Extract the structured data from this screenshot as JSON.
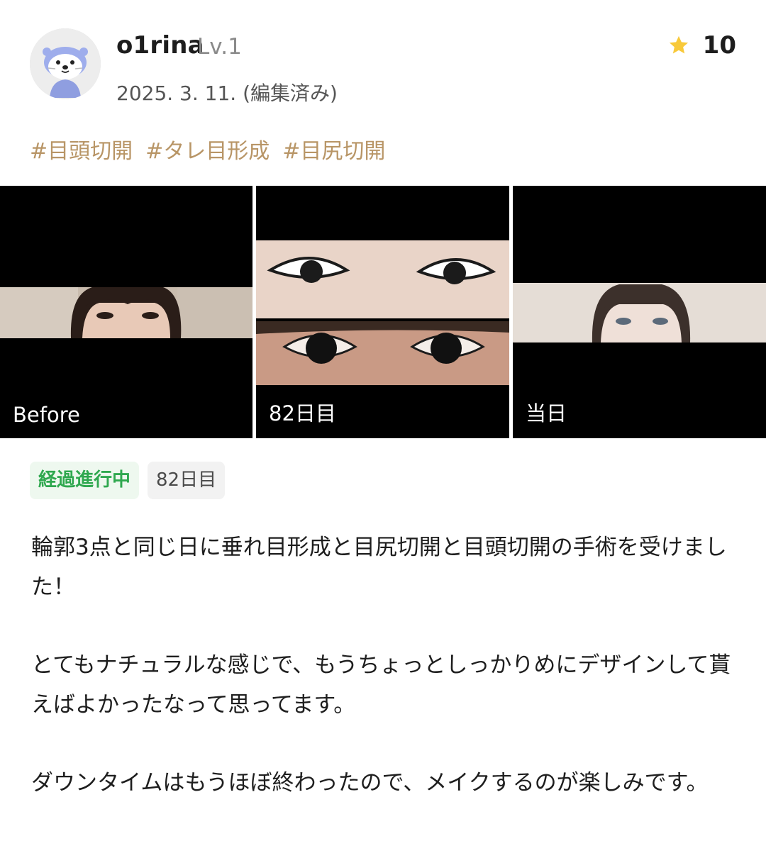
{
  "post": {
    "user": {
      "name": "o1rina",
      "level": "Lv.1",
      "date": "2025. 3. 11. (編集済み)"
    },
    "rating": {
      "score": "10",
      "color": "#f8c93a",
      "icon": "star-icon"
    },
    "tags": [
      "#目頭切開",
      "#タレ目形成",
      "#目尻切開"
    ],
    "photos": [
      {
        "label": "Before"
      },
      {
        "label": "82日目"
      },
      {
        "label": "当日"
      }
    ],
    "badges": {
      "progress": "経過進行中",
      "day": "82日目"
    },
    "paragraphs": [
      "輪郭3点と同じ日に垂れ目形成と目尻切開と目頭切開の手術を受けました！",
      "とてもナチュラルな感じで、もうちょっとしっかりめにデザインして貰えばよかったなって思ってます。",
      "ダウンタイムはもうほぼ終わったので、メイクするのが楽しみです。"
    ]
  }
}
